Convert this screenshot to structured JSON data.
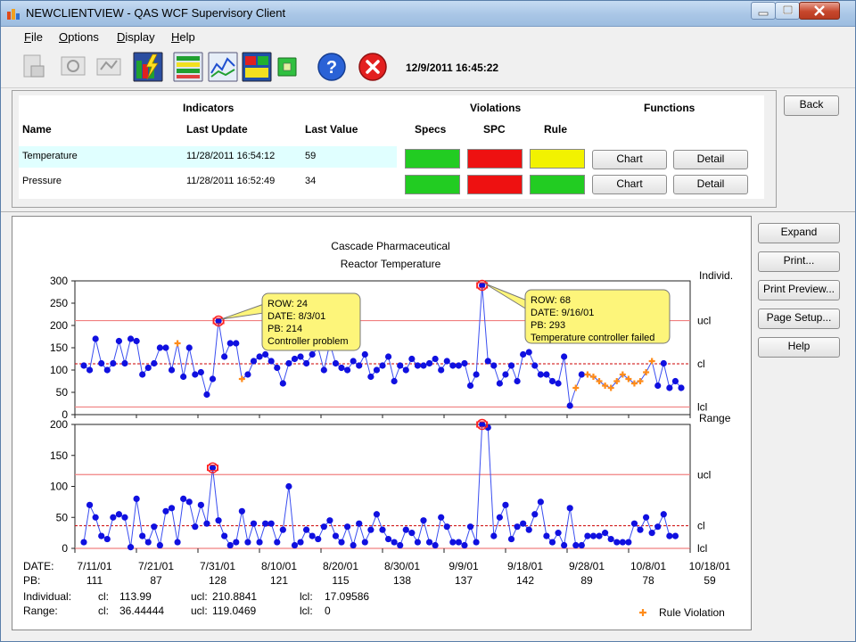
{
  "window": {
    "title": "NEWCLIENTVIEW  -  QAS WCF Supervisory Client"
  },
  "menu": [
    "File",
    "Options",
    "Display",
    "Help"
  ],
  "toolbar": {
    "datetime": "12/9/2011 16:45:22",
    "icons": [
      "print-icon",
      "print-preview-icon",
      "page-setup-icon",
      "lightning-chart-icon",
      "list-view-icon",
      "line-chart-icon",
      "panel-view-icon",
      "stop-icon",
      "help-icon",
      "close-red-icon"
    ]
  },
  "indicators": {
    "group_headers": {
      "indicators": "Indicators",
      "violations": "Violations",
      "functions": "Functions"
    },
    "columns": {
      "name": "Name",
      "last_update": "Last Update",
      "last_value": "Last Value",
      "specs": "Specs",
      "spc": "SPC",
      "rule": "Rule"
    },
    "rows": [
      {
        "name": "Temperature",
        "last_update": "11/28/2011 16:54:12",
        "last_value": "59",
        "specs_color": "#22cc22",
        "spc_color": "#ee1111",
        "rule_color": "#f2f200",
        "chart": "Chart",
        "detail": "Detail"
      },
      {
        "name": "Pressure",
        "last_update": "11/28/2011 16:52:49",
        "last_value": "34",
        "specs_color": "#22cc22",
        "spc_color": "#ee1111",
        "rule_color": "#22cc22",
        "chart": "Chart",
        "detail": "Detail"
      }
    ],
    "back": "Back"
  },
  "side_buttons": [
    "Expand",
    "Print...",
    "Print Preview...",
    "Page Setup...",
    "Help"
  ],
  "chart_data": {
    "type": "line",
    "title": "Cascade Pharmaceutical",
    "subtitle": "Reactor Temperature",
    "individual": {
      "label": "Individ.",
      "ylim": [
        0,
        300
      ],
      "yticks": [
        0,
        50,
        100,
        150,
        200,
        250,
        300
      ],
      "cl": 113.99,
      "ucl": 210.8841,
      "lcl": 17.09586,
      "values": [
        110,
        100,
        170,
        115,
        100,
        115,
        165,
        115,
        170,
        165,
        90,
        105,
        115,
        150,
        150,
        100,
        160,
        85,
        150,
        90,
        95,
        45,
        80,
        210,
        130,
        160,
        160,
        80,
        90,
        120,
        130,
        135,
        120,
        105,
        70,
        115,
        125,
        130,
        115,
        135,
        150,
        100,
        160,
        115,
        105,
        100,
        120,
        110,
        135,
        85,
        100,
        110,
        130,
        75,
        110,
        100,
        125,
        110,
        110,
        115,
        125,
        100,
        120,
        110,
        110,
        115,
        65,
        90,
        290,
        120,
        110,
        70,
        90,
        110,
        75,
        135,
        140,
        110,
        90,
        90,
        75,
        70,
        130,
        20,
        60,
        90,
        90,
        85,
        75,
        65,
        60,
        75,
        90,
        80,
        70,
        75,
        95,
        120,
        65,
        115,
        60,
        75,
        60
      ],
      "rule_violation_indices": [
        16,
        27,
        84,
        86,
        87,
        88,
        89,
        90,
        91,
        92,
        93,
        94,
        95,
        96,
        97
      ],
      "labeled_violations": [
        23,
        68
      ],
      "annotations": [
        {
          "row": "ROW: 24",
          "date": "DATE: 8/3/01",
          "pb": "PB: 214",
          "comment": "Controller problem"
        },
        {
          "row": "ROW: 68",
          "date": "DATE: 9/16/01",
          "pb": "PB: 293",
          "comment": "Temperature controller failed"
        }
      ]
    },
    "range": {
      "label": "Range",
      "ylim": [
        0,
        200
      ],
      "yticks": [
        0,
        50,
        100,
        150,
        200
      ],
      "cl": 36.44444,
      "ucl": 119.0469,
      "lcl": 0,
      "values": [
        10,
        70,
        50,
        20,
        15,
        50,
        55,
        50,
        2,
        80,
        20,
        10,
        35,
        5,
        60,
        65,
        10,
        80,
        75,
        35,
        70,
        40,
        130,
        45,
        20,
        5,
        10,
        60,
        10,
        40,
        10,
        40,
        40,
        10,
        30,
        100,
        5,
        10,
        30,
        20,
        15,
        35,
        45,
        20,
        10,
        35,
        5,
        40,
        10,
        30,
        55,
        30,
        15,
        10,
        5,
        30,
        25,
        10,
        45,
        10,
        5,
        50,
        35,
        10,
        10,
        5,
        35,
        10,
        200,
        195,
        20,
        50,
        70,
        15,
        35,
        40,
        30,
        55,
        75,
        20,
        10,
        25,
        5,
        65,
        5,
        5,
        20,
        20,
        20,
        25,
        15,
        10,
        10,
        10,
        40,
        30,
        50,
        25,
        35,
        55,
        20,
        20
      ],
      "labeled_violations": [
        22,
        68
      ]
    },
    "x_axis": {
      "date_label": "DATE:",
      "pb_label": "PB:",
      "dates": [
        "7/11/01",
        "7/21/01",
        "7/31/01",
        "8/10/01",
        "8/20/01",
        "8/30/01",
        "9/9/01",
        "9/18/01",
        "9/28/01",
        "10/8/01",
        "10/18/01"
      ],
      "pbs": [
        "111",
        "87",
        "128",
        "121",
        "115",
        "138",
        "137",
        "142",
        "89",
        "78",
        "59"
      ]
    },
    "limit_labels": {
      "ucl": "ucl",
      "cl": "cl",
      "lcl": "lcl"
    },
    "summary": {
      "individual_label": "Individual:",
      "range_label": "Range:",
      "cl_label": "cl:",
      "ucl_label": "ucl:",
      "lcl_label": "lcl:",
      "individual": {
        "cl": "113.99",
        "ucl": "210.8841",
        "lcl": "17.09586"
      },
      "range": {
        "cl": "36.44444",
        "ucl": "119.0469",
        "lcl": "0"
      }
    },
    "legend": {
      "label": "Rule Violation",
      "placement": "bottom-right"
    },
    "colors": {
      "point": "#1010e0",
      "line": "#3a4ef0",
      "limit": "#f08080",
      "cl": "#cc0000",
      "violation": "#ff8c1a",
      "flag": "#ff2020"
    }
  }
}
